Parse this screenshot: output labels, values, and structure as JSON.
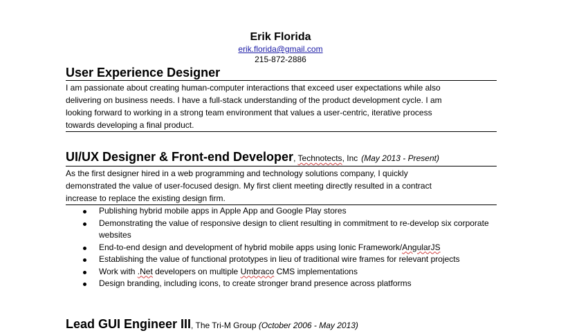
{
  "header": {
    "name": "Erik Florida",
    "email": "erik.florida@gmail.com",
    "phone": "215-872-2886"
  },
  "summary": {
    "title": "User Experience Designer",
    "lines": [
      "I am passionate about creating human-computer interactions that exceed user expectations while also",
      "delivering on business needs. I have a full-stack understanding of the product development cycle. I am",
      "looking forward to working in a strong team environment that values a user-centric, iterative  process",
      "towards developing a final product."
    ]
  },
  "job1": {
    "title": "UI/UX Designer & Front-end Developer",
    "company_sep": ", ",
    "company": "Technotects",
    "company_suffix": ", Inc",
    "dates": "(May 2013 - Present)",
    "summary_lines": [
      "As the first designer hired in a web programming and technology solutions company, I quickly",
      "demonstrated the value of user-focused design. My first client meeting directly resulted in a contract",
      "increase to replace the existing design firm."
    ],
    "bullets": [
      {
        "text": "Publishing hybrid mobile apps in Apple App and Google Play stores"
      },
      {
        "text": "Demonstrating the value of responsive design to client resulting in commitment to re-develop six corporate websites"
      },
      {
        "text_before": "End-to-end design and development of hybrid mobile apps using Ionic Framework/",
        "text_flagged": "AngularJS"
      },
      {
        "text": "Establishing the value of functional prototypes in lieu of traditional wire frames for relevant projects"
      },
      {
        "text_before": "Work with ",
        "text_flagged": ".Net",
        "text_middle": " developers on multiple ",
        "text_flagged2": "Umbraco",
        "text_after": " CMS implementations"
      },
      {
        "text": "Design branding, including icons, to create stronger brand presence across platforms"
      }
    ]
  },
  "job2": {
    "title": "Lead GUI Engineer III",
    "company": ", The Tri-M Group ",
    "dates": "(October 2006 - May 2013)"
  }
}
